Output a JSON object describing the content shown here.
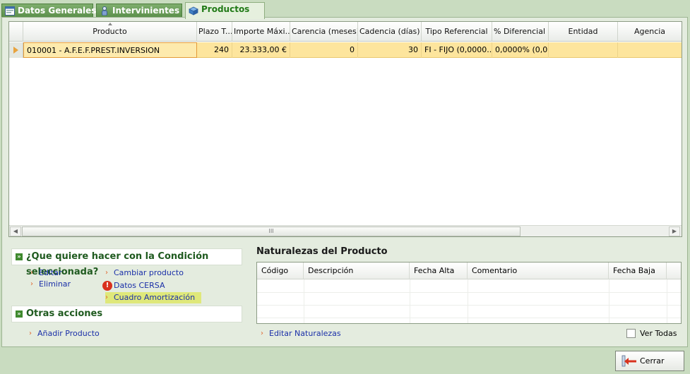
{
  "tabs": [
    {
      "label": "Datos Generales",
      "icon": "form-icon",
      "active": false
    },
    {
      "label": "Intervinientes",
      "icon": "person-icon",
      "active": false
    },
    {
      "label": "Productos",
      "icon": "cube-icon",
      "active": true
    }
  ],
  "grid": {
    "columns": [
      "Producto",
      "Plazo T...",
      "Importe Máxi...",
      "Carencia (meses)",
      "Cadencia (días)",
      "Tipo Referencial",
      "% Diferencial ...",
      "Entidad",
      "Agencia"
    ],
    "rows": [
      {
        "producto": "010001 - A.F.E.F.PREST.INVERSION",
        "plazo": "240",
        "importe": "23.333,00 €",
        "carencia": "0",
        "cadencia": "30",
        "tipo_referencial": "FI - FIJO (0,0000...",
        "diferencial": "0,0000% (0,0...",
        "entidad": "",
        "agencia": ""
      }
    ],
    "scroll_thumb_glyph": "III"
  },
  "actions": {
    "condicion_title": "¿Que quiere hacer con la Condición seleccionada?",
    "editar": "Editar",
    "eliminar": "Eliminar",
    "cambiar_producto": "Cambiar producto",
    "datos_cersa": "Datos CERSA",
    "cuadro_amortizacion": "Cuadro Amortización",
    "otras_title": "Otras acciones",
    "anadir_producto": "Añadir Producto"
  },
  "naturalezas": {
    "title": "Naturalezas del Producto",
    "columns": [
      "Código",
      "Descripción",
      "Fecha Alta",
      "Comentario",
      "Fecha Baja"
    ],
    "editar_link": "Editar Naturalezas",
    "ver_todas_label": "Ver Todas",
    "ver_todas_checked": false
  },
  "footer": {
    "cerrar_label": "Cerrar"
  },
  "colors": {
    "selected_row": "#fde59d",
    "accent_green": "#217a17",
    "link_blue": "#1a2fa8",
    "bullet_orange": "#e0642a",
    "warning_red": "#d9311e",
    "highlight": "#dfe87a"
  }
}
